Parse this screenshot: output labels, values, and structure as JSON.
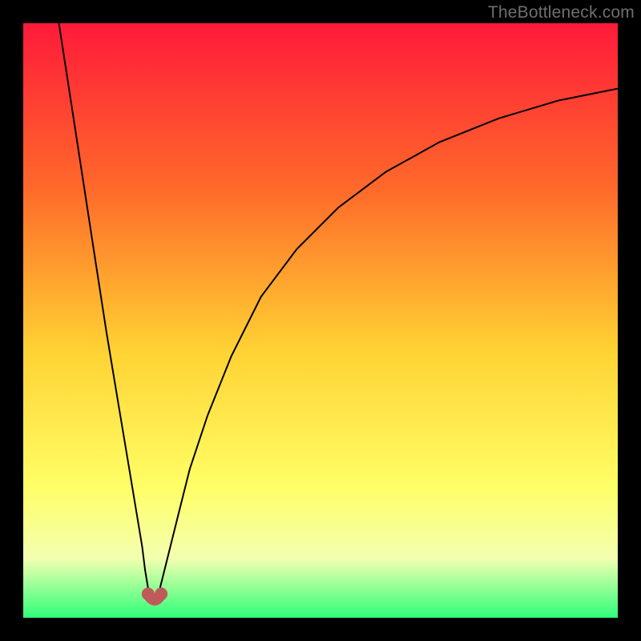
{
  "attribution": "TheBottleneck.com",
  "colors": {
    "page_bg": "#000000",
    "gradient_top": "#ff1a3a",
    "gradient_mid1": "#ff6a2a",
    "gradient_mid2": "#ffd233",
    "gradient_mid3": "#ffff66",
    "gradient_mid4": "#f3ffb0",
    "gradient_bottom": "#2fff7a",
    "curve": "#000000",
    "dot": "#c05a5a",
    "attribution_text": "#6f6f6f"
  },
  "chart_data": {
    "type": "line",
    "title": "",
    "xlabel": "",
    "ylabel": "",
    "xlim": [
      0,
      100
    ],
    "ylim": [
      0,
      100
    ],
    "grid": false,
    "legend": false,
    "series": [
      {
        "name": "left-branch",
        "x": [
          6,
          8,
          10,
          12,
          14,
          16,
          18,
          20,
          20.5,
          21,
          21.5
        ],
        "y": [
          100,
          87,
          74,
          61,
          48,
          36,
          24,
          12,
          8,
          5,
          2.5
        ]
      },
      {
        "name": "right-branch",
        "x": [
          22.5,
          23,
          24,
          26,
          28,
          31,
          35,
          40,
          46,
          53,
          61,
          70,
          80,
          90,
          100
        ],
        "y": [
          2.5,
          5,
          9,
          17,
          25,
          34,
          44,
          54,
          62,
          69,
          75,
          80,
          84,
          87,
          89
        ]
      }
    ],
    "highlight_points": [
      {
        "name": "left-dot",
        "x": 21.0,
        "y": 4.0
      },
      {
        "name": "right-dot",
        "x": 23.2,
        "y": 4.0
      }
    ],
    "highlight_trough": {
      "x": 22.1,
      "y": 2.0
    }
  }
}
